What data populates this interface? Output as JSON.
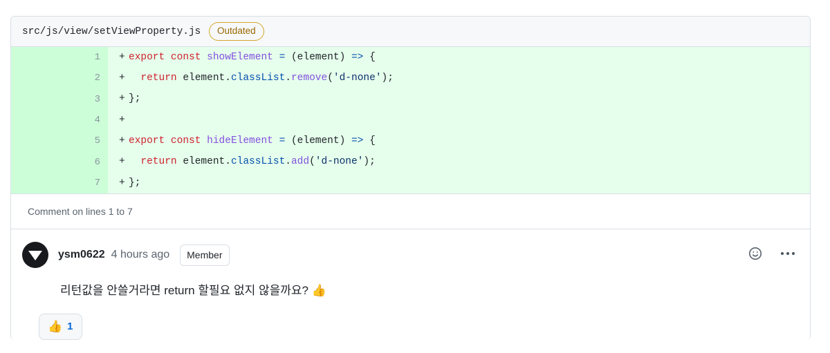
{
  "file_header": {
    "path": "src/js/view/setViewProperty.js",
    "status_badge": "Outdated"
  },
  "diff": {
    "lines": [
      {
        "number": "1",
        "marker": "+",
        "tokens": [
          {
            "t": "export",
            "c": "k"
          },
          {
            "t": " ",
            "c": "pl"
          },
          {
            "t": "const",
            "c": "k"
          },
          {
            "t": " ",
            "c": "pl"
          },
          {
            "t": "showElement",
            "c": "fn"
          },
          {
            "t": " ",
            "c": "pl"
          },
          {
            "t": "=",
            "c": "op"
          },
          {
            "t": " (element) ",
            "c": "pl"
          },
          {
            "t": "=>",
            "c": "op"
          },
          {
            "t": " {",
            "c": "pl"
          }
        ]
      },
      {
        "number": "2",
        "marker": "+",
        "tokens": [
          {
            "t": "  ",
            "c": "pl"
          },
          {
            "t": "return",
            "c": "k"
          },
          {
            "t": " element.",
            "c": "pl"
          },
          {
            "t": "classList",
            "c": "pr"
          },
          {
            "t": ".",
            "c": "pl"
          },
          {
            "t": "remove",
            "c": "fn"
          },
          {
            "t": "(",
            "c": "pl"
          },
          {
            "t": "'d-none'",
            "c": "st"
          },
          {
            "t": ");",
            "c": "pl"
          }
        ]
      },
      {
        "number": "3",
        "marker": "+",
        "tokens": [
          {
            "t": "};",
            "c": "pl"
          }
        ]
      },
      {
        "number": "4",
        "marker": "+",
        "tokens": [
          {
            "t": "",
            "c": "pl"
          }
        ]
      },
      {
        "number": "5",
        "marker": "+",
        "tokens": [
          {
            "t": "export",
            "c": "k"
          },
          {
            "t": " ",
            "c": "pl"
          },
          {
            "t": "const",
            "c": "k"
          },
          {
            "t": " ",
            "c": "pl"
          },
          {
            "t": "hideElement",
            "c": "fn"
          },
          {
            "t": " ",
            "c": "pl"
          },
          {
            "t": "=",
            "c": "op"
          },
          {
            "t": " (element) ",
            "c": "pl"
          },
          {
            "t": "=>",
            "c": "op"
          },
          {
            "t": " {",
            "c": "pl"
          }
        ]
      },
      {
        "number": "6",
        "marker": "+",
        "tokens": [
          {
            "t": "  ",
            "c": "pl"
          },
          {
            "t": "return",
            "c": "k"
          },
          {
            "t": " element.",
            "c": "pl"
          },
          {
            "t": "classList",
            "c": "pr"
          },
          {
            "t": ".",
            "c": "pl"
          },
          {
            "t": "add",
            "c": "fn"
          },
          {
            "t": "(",
            "c": "pl"
          },
          {
            "t": "'d-none'",
            "c": "st"
          },
          {
            "t": ");",
            "c": "pl"
          }
        ]
      },
      {
        "number": "7",
        "marker": "+",
        "tokens": [
          {
            "t": "};",
            "c": "pl"
          }
        ]
      }
    ]
  },
  "comment_on_lines": "Comment on lines 1 to 7",
  "comment": {
    "author": "ysm0622",
    "timestamp": "4 hours ago",
    "role_badge": "Member",
    "body": "리턴값을 안쓸거라면 return 할필요 없지 않을까요? 👍",
    "avatar_icon": "triangle-down-avatar",
    "actions": {
      "add_reaction_icon": "smiley-icon",
      "more_options_icon": "kebab-horizontal-icon"
    }
  },
  "reactions": [
    {
      "emoji": "👍",
      "count": "1",
      "active": true
    }
  ],
  "colors": {
    "diff_add_bg": "#e6ffec",
    "diff_add_gutter_bg": "#ccffd8",
    "border": "#d8dee4",
    "header_bg": "#f6f8fa",
    "badge_outdated_border": "#d4a72c",
    "badge_outdated_text": "#9a6700",
    "keyword": "#cf222e",
    "function": "#8250df",
    "operator": "#0550ae",
    "string": "#0a3069",
    "accent_blue": "#0969da",
    "muted_text": "#59636e"
  }
}
